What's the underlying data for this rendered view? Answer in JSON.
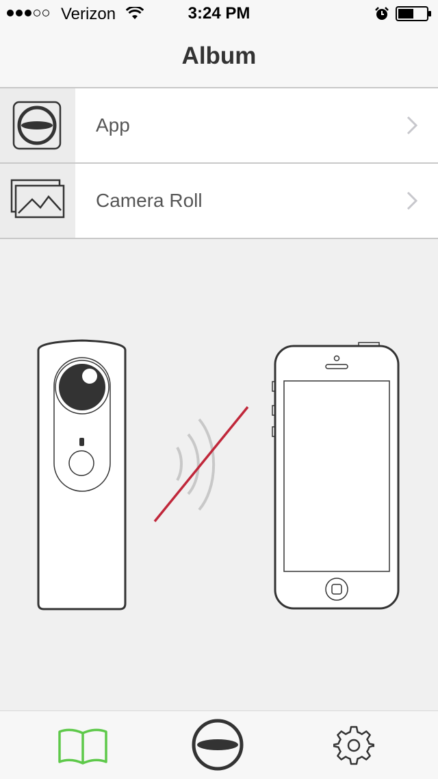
{
  "status_bar": {
    "signal_bars_filled": 3,
    "signal_bars_total": 5,
    "carrier": "Verizon",
    "time": "3:24 PM",
    "battery_level": 0.55
  },
  "nav": {
    "title": "Album"
  },
  "list": {
    "items": [
      {
        "label": "App",
        "icon": "theta-app-icon"
      },
      {
        "label": "Camera Roll",
        "icon": "photos-icon"
      }
    ]
  },
  "illustration": {
    "camera": "theta-camera-icon",
    "phone": "smartphone-icon",
    "connection": "wifi-disconnected-icon",
    "slash_color": "#c0273a"
  },
  "tab_bar": {
    "tabs": [
      {
        "icon": "album-book-icon",
        "selected": true,
        "color": "#5ec94a"
      },
      {
        "icon": "theta-capture-icon",
        "selected": false
      },
      {
        "icon": "gear-icon",
        "selected": false
      }
    ]
  },
  "colors": {
    "accent_green": "#5ec94a",
    "icon_dark": "#333333",
    "slash_red": "#c0273a"
  }
}
